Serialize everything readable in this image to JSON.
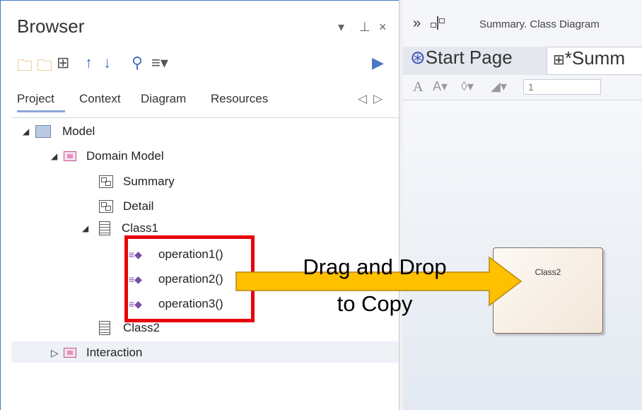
{
  "browser": {
    "title": "Browser",
    "controls": {
      "pin": "▾",
      "dock": "⊥",
      "close": "×"
    },
    "tabs": [
      "Project",
      "Context",
      "Diagram",
      "Resources"
    ],
    "tab_nav": {
      "prev": "◁",
      "next": "▷"
    }
  },
  "tree": {
    "model": "Model",
    "domain_model": "Domain Model",
    "summary": "Summary",
    "detail": "Detail",
    "class1": "Class1",
    "operations": [
      "operation1()",
      "operation2()",
      "operation3()"
    ],
    "class2": "Class2",
    "interaction": "Interaction"
  },
  "diagram_pane": {
    "breadcrumb": "Summary. Class Diagram",
    "tab_start": "Start Page",
    "tab_summary": "*Summ",
    "zoom_value": "1",
    "class_name": "Class2"
  },
  "annotation": {
    "line1": "Drag and Drop",
    "line2": "to Copy"
  },
  "colors": {
    "highlight_box": "#e8000b",
    "arrow_fill": "#ffc000",
    "arrow_stroke": "#b8860b"
  }
}
